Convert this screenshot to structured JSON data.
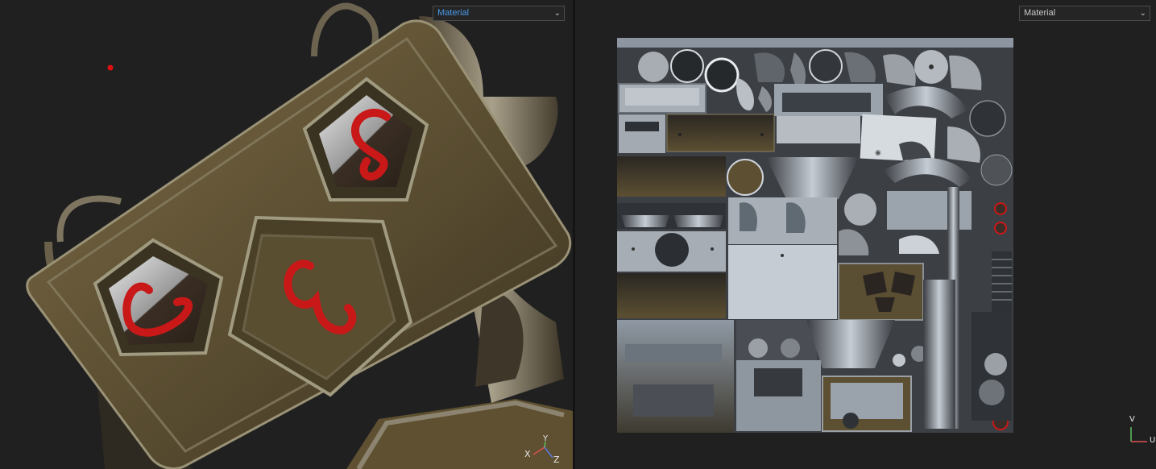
{
  "viewport_3d": {
    "material_dropdown": "Material",
    "gizmo": {
      "x": "X",
      "y": "Y",
      "z": "Z"
    },
    "button_glyphs": [
      "S",
      "C",
      "W"
    ]
  },
  "viewport_uv": {
    "material_dropdown": "Material",
    "gizmo": {
      "v": "V",
      "u": "U"
    }
  },
  "colors": {
    "background": "#202020",
    "model_body": "#5c4f32",
    "glyph_red": "#c81818",
    "uv_metal": "#9aa6b2"
  }
}
